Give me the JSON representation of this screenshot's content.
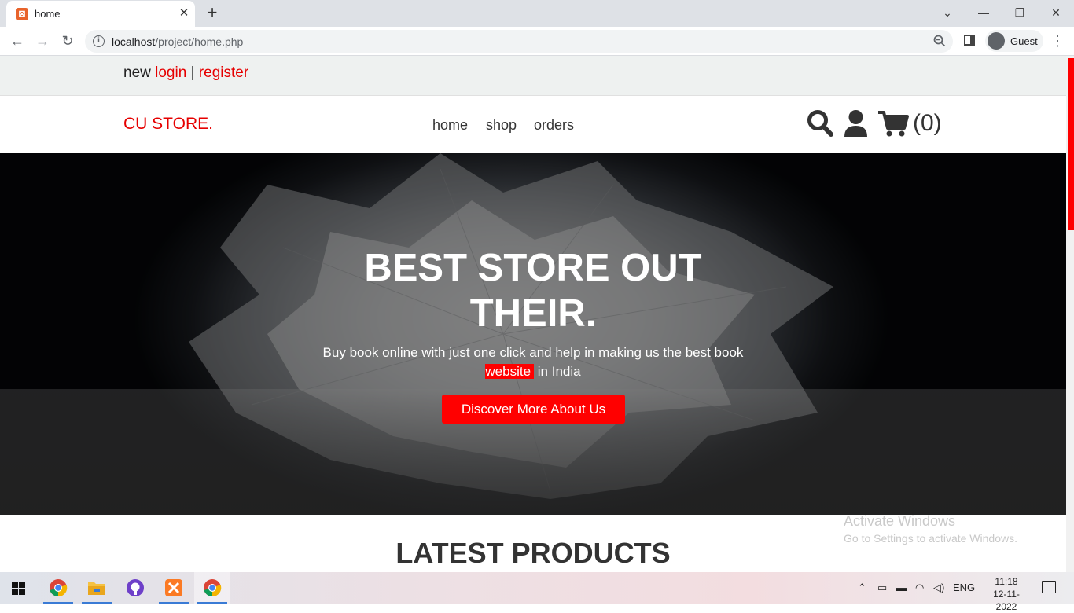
{
  "browser": {
    "tab_title": "home",
    "url_host": "localhost",
    "url_path": "/project/home.php",
    "profile_label": "Guest"
  },
  "topbar": {
    "prefix": "new",
    "login": "login",
    "separator": "|",
    "register": "register"
  },
  "header": {
    "logo": "CU STORE.",
    "nav": [
      "home",
      "shop",
      "orders"
    ],
    "cart_count": "(0)"
  },
  "hero": {
    "title_line1": "BEST STORE OUT",
    "title_line2": "THEIR.",
    "text_before": "Buy book online with just one click and help in making us the best book",
    "text_highlight": "website",
    "text_after": " in India",
    "button": "Discover More About Us"
  },
  "section": {
    "latest_title": "LATEST PRODUCTS"
  },
  "watermark": {
    "line1": "Activate Windows",
    "line2": "Go to Settings to activate Windows."
  },
  "taskbar": {
    "lang": "ENG",
    "time": "11:18",
    "date": "12-11-2022"
  },
  "colors": {
    "accent": "#ff0000",
    "brand_text": "#e60000"
  }
}
